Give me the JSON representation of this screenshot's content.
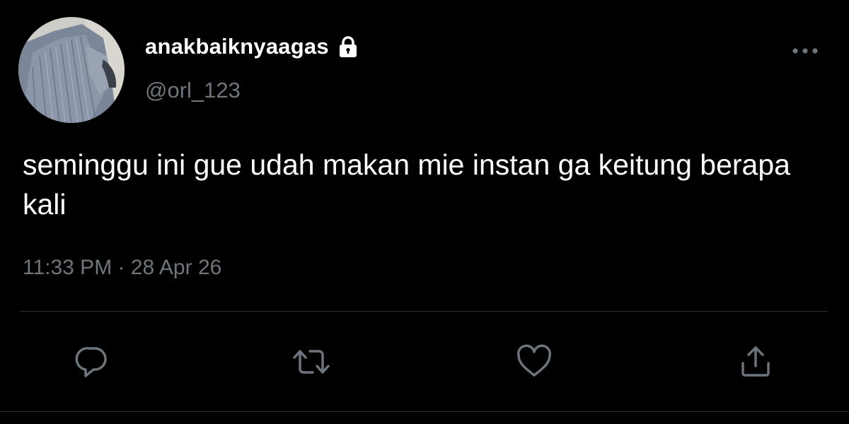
{
  "tweet": {
    "display_name": "anakbaiknyaagas",
    "handle": "@orl_123",
    "protected": true,
    "text": "seminggu ini gue udah makan mie instan ga keitung berapa kali",
    "time": "11:33 PM",
    "separator": "·",
    "date": "28 Apr 26"
  },
  "icons": {
    "lock": "lock-icon",
    "more": "more-horizontal-icon",
    "reply": "reply-icon",
    "retweet": "retweet-icon",
    "like": "heart-icon",
    "share": "share-icon"
  },
  "colors": {
    "background": "#000000",
    "primary_text": "#ffffff",
    "secondary_text": "#6e767d",
    "divider": "#2f3336"
  }
}
